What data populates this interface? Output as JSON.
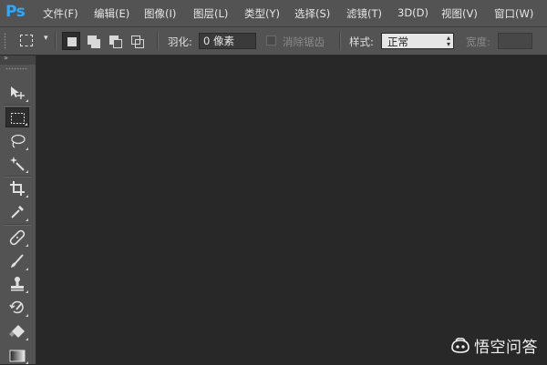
{
  "app": {
    "logo": "Ps"
  },
  "menu": {
    "items": [
      "文件(F)",
      "编辑(E)",
      "图像(I)",
      "图层(L)",
      "类型(Y)",
      "选择(S)",
      "滤镜(T)",
      "3D(D)",
      "视图(V)",
      "窗口(W)"
    ]
  },
  "options": {
    "feather_label": "羽化:",
    "feather_value": "0 像素",
    "antialias_label": "消除锯齿",
    "antialias_checked": false,
    "style_label": "样式:",
    "style_value": "正常",
    "width_label": "宽度:",
    "width_value": ""
  },
  "toolbox": {
    "tools": [
      {
        "name": "move-tool",
        "icon": "move-icon",
        "active": false
      },
      {
        "name": "rectangular-marquee-tool",
        "icon": "marquee-icon",
        "active": true
      },
      {
        "name": "lasso-tool",
        "icon": "lasso-icon",
        "active": false
      },
      {
        "name": "magic-wand-tool",
        "icon": "magic-wand-icon",
        "active": false
      },
      {
        "name": "crop-tool",
        "icon": "crop-icon",
        "active": false
      },
      {
        "name": "eyedropper-tool",
        "icon": "eyedropper-icon",
        "active": false
      },
      {
        "name": "healing-brush-tool",
        "icon": "bandage-icon",
        "active": false
      },
      {
        "name": "brush-tool",
        "icon": "brush-icon",
        "active": false
      },
      {
        "name": "clone-stamp-tool",
        "icon": "stamp-icon",
        "active": false
      },
      {
        "name": "history-brush-tool",
        "icon": "history-brush-icon",
        "active": false
      },
      {
        "name": "eraser-tool",
        "icon": "eraser-icon",
        "active": false
      },
      {
        "name": "gradient-tool",
        "icon": "gradient-icon",
        "active": false
      }
    ]
  },
  "watermark": {
    "text": "悟空问答"
  },
  "colors": {
    "chrome": "#535353",
    "canvas": "#282828",
    "ps_blue": "#31a8ff"
  }
}
